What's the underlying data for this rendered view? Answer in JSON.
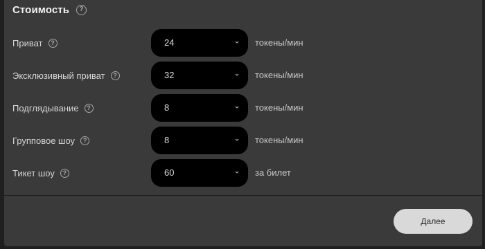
{
  "section": {
    "title": "Стоимость",
    "help_glyph": "?"
  },
  "rows": [
    {
      "label": "Приват",
      "value": "24",
      "unit": "токены/мин"
    },
    {
      "label": "Эксклюзивный приват",
      "value": "32",
      "unit": "токены/мин"
    },
    {
      "label": "Подглядывание",
      "value": "8",
      "unit": "токены/мин"
    },
    {
      "label": "Групповое шоу",
      "value": "8",
      "unit": "токены/мин"
    },
    {
      "label": "Тикет шоу",
      "value": "60",
      "unit": "за билет"
    }
  ],
  "footer": {
    "next_label": "Далее"
  },
  "icons": {
    "help": "question-circle-icon",
    "chevron": "chevron-down-icon"
  },
  "colors": {
    "panel_bg": "#3a3a3a",
    "select_bg": "#000000",
    "button_bg": "#d9d9d9"
  }
}
